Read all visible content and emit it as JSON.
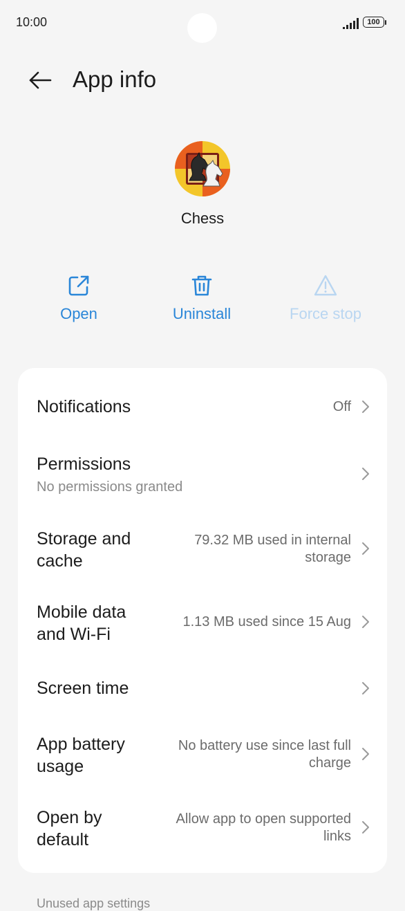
{
  "status_bar": {
    "time": "10:00",
    "battery_level": "100"
  },
  "header": {
    "title": "App info"
  },
  "app": {
    "name": "Chess",
    "icon": "chess-knight-icon"
  },
  "actions": [
    {
      "label": "Open",
      "icon": "open-external-icon",
      "enabled": true
    },
    {
      "label": "Uninstall",
      "icon": "trash-icon",
      "enabled": true
    },
    {
      "label": "Force stop",
      "icon": "warning-icon",
      "enabled": false
    }
  ],
  "settings": [
    {
      "title": "Notifications",
      "value": "Off"
    },
    {
      "title": "Permissions",
      "subtitle": "No permissions granted"
    },
    {
      "title_line1": "Storage and",
      "title_line2": "cache",
      "value_line1": "79.32 MB used in internal",
      "value_line2": "storage"
    },
    {
      "title_line1": "Mobile data",
      "title_line2": "and Wi-Fi",
      "value": "1.13 MB used since 15 Aug"
    },
    {
      "title": "Screen time"
    },
    {
      "title_line1": "App battery",
      "title_line2": "usage",
      "value_line1": "No battery use since last full",
      "value_line2": "charge"
    },
    {
      "title_line1": "Open by",
      "title_line2": "default",
      "value_line1": "Allow app to open supported",
      "value_line2": "links"
    }
  ],
  "section": {
    "label": "Unused app settings"
  },
  "colors": {
    "accent": "#2a86d8",
    "accent_disabled": "#b9d6f1",
    "background": "#f5f5f5",
    "card": "#ffffff"
  }
}
